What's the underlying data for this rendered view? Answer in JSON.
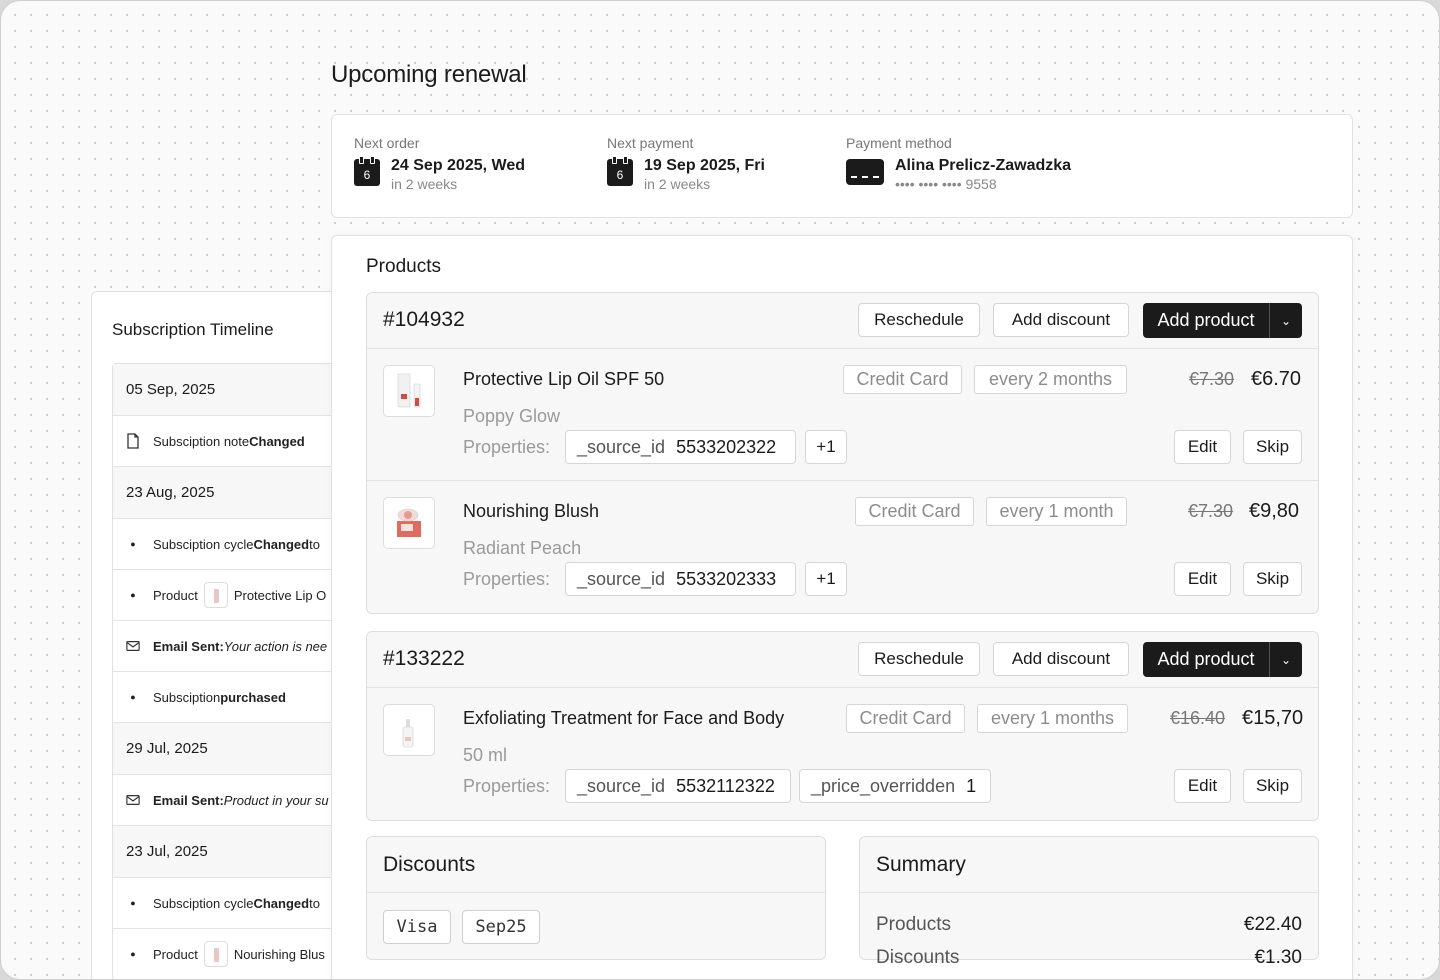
{
  "page": {
    "heading": "Upcoming renewal"
  },
  "renewal": {
    "next_order": {
      "label": "Next order",
      "day": "6",
      "date": "24 Sep 2025, Wed",
      "relative": "in 2 weeks"
    },
    "next_payment": {
      "label": "Next payment",
      "day": "6",
      "date": "19 Sep 2025, Fri",
      "relative": "in 2 weeks"
    },
    "payment_method": {
      "label": "Payment method",
      "name": "Alina Prelicz-Zawadzka",
      "masked": "•••• •••• •••• 9558"
    }
  },
  "timeline": {
    "title": "Subscription Timeline",
    "entries": [
      {
        "type": "date",
        "text": "05 Sep, 2025"
      },
      {
        "type": "event",
        "icon": "note-icon",
        "pre": "Subsciption note ",
        "bold": "Changed",
        "post": ""
      },
      {
        "type": "date",
        "text": "23 Aug, 2025"
      },
      {
        "type": "event",
        "icon": "bullet-icon",
        "pre": "Subsciption cycle ",
        "bold": "Changed",
        "post": " to"
      },
      {
        "type": "product",
        "icon": "bullet-icon",
        "pre": "Product",
        "post": "Protective Lip O"
      },
      {
        "type": "email",
        "icon": "mail-icon",
        "bold": "Email Sent:",
        "italic": " Your action is nee"
      },
      {
        "type": "event",
        "icon": "bullet-icon",
        "pre": "Subsciption ",
        "bold": "purchased",
        "post": ""
      },
      {
        "type": "date",
        "text": "29 Jul, 2025"
      },
      {
        "type": "email",
        "icon": "mail-icon",
        "bold": "Email Sent:",
        "italic": " Product in your su"
      },
      {
        "type": "date",
        "text": "23 Jul, 2025"
      },
      {
        "type": "event",
        "icon": "bullet-icon",
        "pre": "Subsciption cycle ",
        "bold": "Changed",
        "post": " to"
      },
      {
        "type": "product",
        "icon": "bullet-icon",
        "pre": "Product",
        "post": "Nourishing Blus"
      }
    ]
  },
  "products": {
    "title": "Products",
    "buttons": {
      "reschedule": "Reschedule",
      "add_discount": "Add discount",
      "add_product": "Add product",
      "edit": "Edit",
      "skip": "Skip",
      "properties": "Properties:"
    },
    "orders": [
      {
        "id": "#104932",
        "items": [
          {
            "name": "Protective Lip Oil SPF 50",
            "variant": "Poppy Glow",
            "payment": "Credit Card",
            "frequency": "every 2 months",
            "old_price": "€7.30",
            "price": "€6.70",
            "props": [
              {
                "k": "_source_id",
                "v": "5533202322"
              }
            ],
            "extra": "+1"
          },
          {
            "name": "Nourishing Blush",
            "variant": "Radiant Peach",
            "payment": "Credit Card",
            "frequency": "every 1 month",
            "old_price": "€7.30",
            "price": "€9,80",
            "props": [
              {
                "k": "_source_id",
                "v": "5533202333"
              }
            ],
            "extra": "+1"
          }
        ]
      },
      {
        "id": "#133222",
        "items": [
          {
            "name": "Exfoliating Treatment for Face and Body",
            "variant": "50 ml",
            "payment": "Credit Card",
            "frequency": "every 1 months",
            "old_price": "€16.40",
            "price": "€15,70",
            "props": [
              {
                "k": "_source_id",
                "v": "5532112322"
              },
              {
                "k": "_price_overridden",
                "v": "1"
              }
            ],
            "extra": ""
          }
        ]
      }
    ]
  },
  "discounts": {
    "title": "Discounts",
    "codes": [
      "Visa",
      "Sep25"
    ]
  },
  "summary": {
    "title": "Summary",
    "rows": [
      {
        "label": "Products",
        "amount": "€22.40"
      },
      {
        "label": "Discounts",
        "amount": "€1.30"
      }
    ]
  }
}
